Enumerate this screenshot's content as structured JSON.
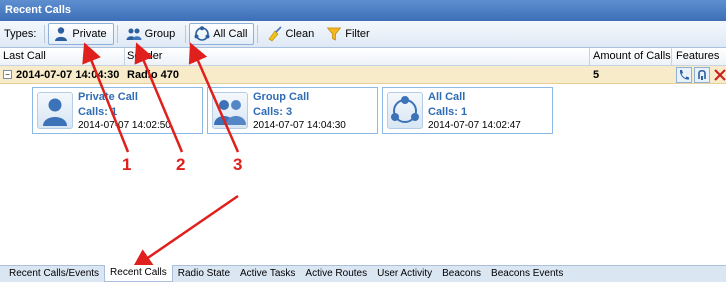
{
  "window": {
    "title": "Recent Calls"
  },
  "toolbar": {
    "types_label": "Types:",
    "buttons": [
      {
        "label": "Private",
        "icon": "person-icon",
        "selected": true
      },
      {
        "label": "Group",
        "icon": "group-icon",
        "selected": false
      },
      {
        "label": "All Call",
        "icon": "all-call-icon",
        "selected": true
      },
      {
        "label": "Clean",
        "icon": "broom-icon",
        "selected": false
      },
      {
        "label": "Filter",
        "icon": "funnel-icon",
        "selected": false
      }
    ]
  },
  "grid": {
    "columns": [
      "Last Call",
      "Sender",
      "Amount of Calls",
      "Features"
    ],
    "group_row": {
      "last_call": "2014-07-07 14:04:30",
      "sender": "Radio 470",
      "amount": "5",
      "features": [
        "phone-icon",
        "ptt-icon",
        "delete-icon"
      ]
    },
    "cards": [
      {
        "title": "Private Call",
        "calls": "Calls: 1",
        "time": "2014-07-07 14:02:50",
        "icon": "person-icon"
      },
      {
        "title": "Group Call",
        "calls": "Calls: 3",
        "time": "2014-07-07 14:04:30",
        "icon": "group-icon"
      },
      {
        "title": "All Call",
        "calls": "Calls: 1",
        "time": "2014-07-07 14:02:47",
        "icon": "all-call-icon"
      }
    ]
  },
  "annotations": [
    "1",
    "2",
    "3"
  ],
  "colors": {
    "annotation": "#e0201c",
    "group_row": "#f7ebc9",
    "card_title": "#2f6cb5",
    "title_bar": "#4a7cc3"
  },
  "tabs": [
    {
      "label": "Recent Calls/Events",
      "active": false
    },
    {
      "label": "Recent Calls",
      "active": true
    },
    {
      "label": "Radio State",
      "active": false
    },
    {
      "label": "Active Tasks",
      "active": false
    },
    {
      "label": "Active Routes",
      "active": false
    },
    {
      "label": "User Activity",
      "active": false
    },
    {
      "label": "Beacons",
      "active": false
    },
    {
      "label": "Beacons Events",
      "active": false
    }
  ]
}
